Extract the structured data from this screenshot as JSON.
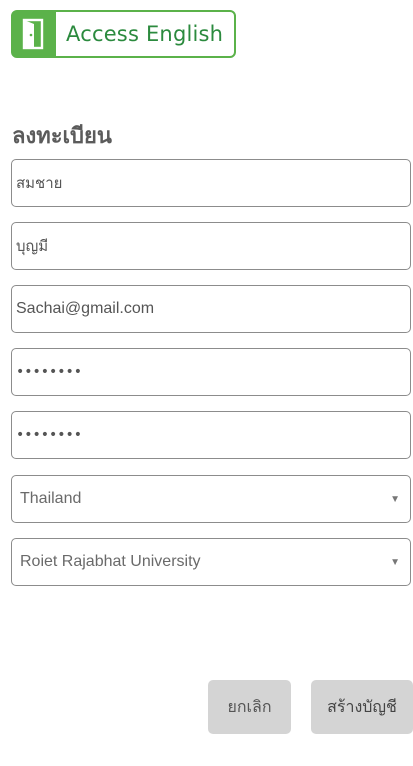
{
  "logo": {
    "text": "Access English",
    "icon": "door-icon",
    "color": "#5bb24a"
  },
  "heading": "ลงทะเบียน",
  "fields": {
    "first_name": "สมชาย",
    "last_name": "บุญมี",
    "email": "Sachai@gmail.com",
    "password": "••••••••",
    "confirm_password": "••••••••"
  },
  "country": {
    "selected": "Thailand"
  },
  "university": {
    "selected": "Roiet Rajabhat University"
  },
  "buttons": {
    "cancel": "ยกเลิก",
    "create": "สร้างบัญชี"
  }
}
